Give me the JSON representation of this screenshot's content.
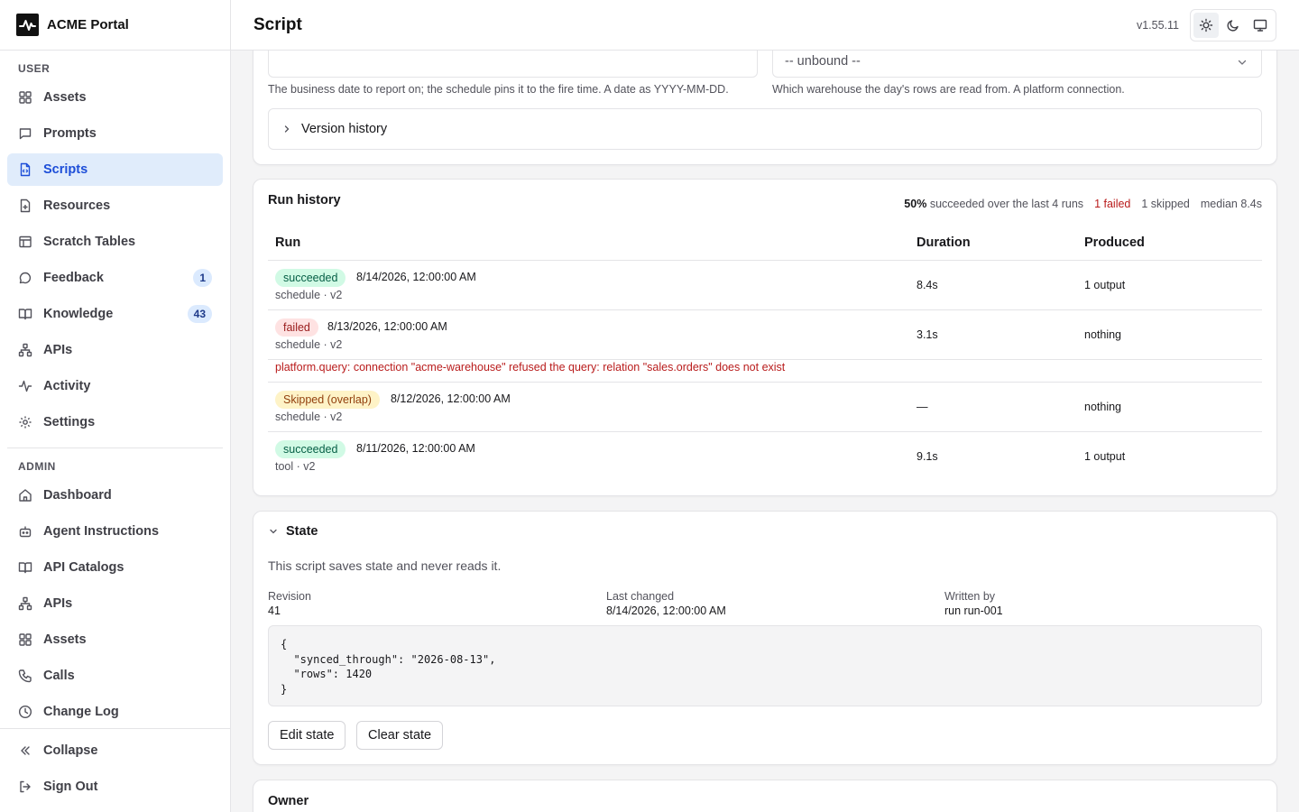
{
  "app": {
    "name": "ACME Portal"
  },
  "sidebar": {
    "user_label": "USER",
    "user_items": [
      {
        "label": "Assets",
        "icon": "grid-icon"
      },
      {
        "label": "Prompts",
        "icon": "message-square-icon"
      },
      {
        "label": "Scripts",
        "icon": "file-code-icon",
        "active": true
      },
      {
        "label": "Resources",
        "icon": "file-plus-icon"
      },
      {
        "label": "Scratch Tables",
        "icon": "table-icon"
      },
      {
        "label": "Feedback",
        "icon": "message-circle-icon",
        "badge": "1"
      },
      {
        "label": "Knowledge",
        "icon": "book-open-icon",
        "badge": "43"
      },
      {
        "label": "APIs",
        "icon": "network-icon"
      },
      {
        "label": "Activity",
        "icon": "activity-icon"
      },
      {
        "label": "Settings",
        "icon": "gear-icon"
      }
    ],
    "admin_label": "ADMIN",
    "admin_items": [
      {
        "label": "Dashboard",
        "icon": "home-icon"
      },
      {
        "label": "Agent Instructions",
        "icon": "bot-icon"
      },
      {
        "label": "API Catalogs",
        "icon": "book-open-icon"
      },
      {
        "label": "APIs",
        "icon": "network-icon"
      },
      {
        "label": "Assets",
        "icon": "grid-icon"
      },
      {
        "label": "Calls",
        "icon": "phone-icon"
      },
      {
        "label": "Change Log",
        "icon": "clock-icon"
      }
    ],
    "collapse_label": "Collapse",
    "signout_label": "Sign Out"
  },
  "header": {
    "title": "Script",
    "version": "v1.55.11",
    "theme_modes": [
      "light",
      "dark",
      "system"
    ],
    "active_theme": "light"
  },
  "params": {
    "date_help": "The business date to report on; the schedule pins it to the fire time. A date as YYYY-MM-DD.",
    "warehouse_value": "-- unbound --",
    "warehouse_help": "Which warehouse the day's rows are read from. A platform connection.",
    "version_history_label": "Version history"
  },
  "run_history": {
    "title": "Run history",
    "summary": {
      "pct": "50%",
      "text": "succeeded over the last 4 runs",
      "failed": "1 failed",
      "skipped": "1 skipped",
      "median": "median 8.4s"
    },
    "columns": {
      "run": "Run",
      "duration": "Duration",
      "produced": "Produced"
    },
    "rows": [
      {
        "status": "succeeded",
        "status_kind": "ok",
        "timestamp": "8/14/2026, 12:00:00 AM",
        "source": "schedule · v2",
        "duration": "8.4s",
        "produced": "1 output"
      },
      {
        "status": "failed",
        "status_kind": "bad",
        "timestamp": "8/13/2026, 12:00:00 AM",
        "source": "schedule · v2",
        "duration": "3.1s",
        "produced": "nothing",
        "error": "platform.query: connection \"acme-warehouse\" refused the query: relation \"sales.orders\" does not exist"
      },
      {
        "status": "Skipped (overlap)",
        "status_kind": "skip",
        "timestamp": "8/12/2026, 12:00:00 AM",
        "source": "schedule · v2",
        "duration": "—",
        "produced": "nothing"
      },
      {
        "status": "succeeded",
        "status_kind": "ok",
        "timestamp": "8/11/2026, 12:00:00 AM",
        "source": "tool · v2",
        "duration": "9.1s",
        "produced": "1 output"
      }
    ]
  },
  "state": {
    "title": "State",
    "description": "This script saves state and never reads it.",
    "revision_label": "Revision",
    "revision": "41",
    "last_changed_label": "Last changed",
    "last_changed": "8/14/2026, 12:00:00 AM",
    "written_by_label": "Written by",
    "written_by": "run run-001",
    "json": "{\n  \"synced_through\": \"2026-08-13\",\n  \"rows\": 1420\n}",
    "edit_label": "Edit state",
    "clear_label": "Clear state"
  },
  "owner": {
    "title": "Owner"
  },
  "colors": {
    "accent": "#1d4ed8",
    "active_bg": "#e0ecfb",
    "error": "#b91c1c",
    "success_bg": "#d1fae5",
    "fail_bg": "#fee2e2",
    "skip_bg": "#fef3c7"
  }
}
